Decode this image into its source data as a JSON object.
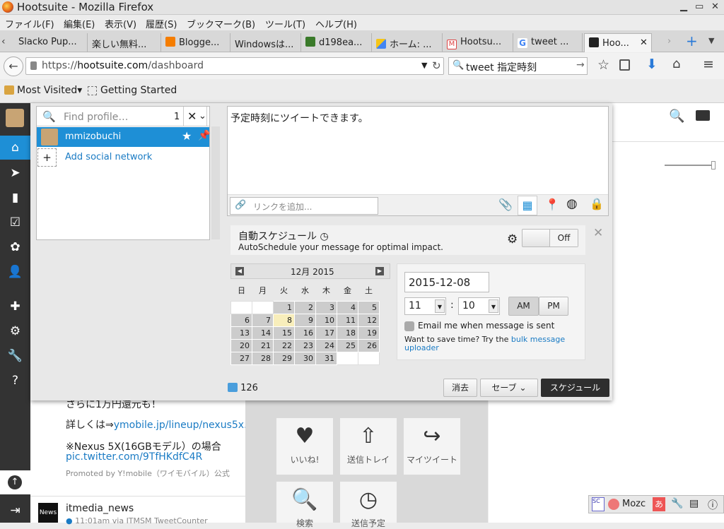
{
  "window": {
    "title": "Hootsuite - Mozilla Firefox"
  },
  "menu": [
    "ファイル(F)",
    "編集(E)",
    "表示(V)",
    "履歴(S)",
    "ブックマーク(B)",
    "ツール(T)",
    "ヘルプ(H)"
  ],
  "tabs": [
    {
      "label": "Slacko Pup...",
      "color": "#fff"
    },
    {
      "label": "楽しい無料...",
      "color": "#fff"
    },
    {
      "label": "Blogge...",
      "color": "#f57d00"
    },
    {
      "label": "Windowsは...",
      "color": "#fff"
    },
    {
      "label": "d198ea...",
      "color": "#3a7a2a"
    },
    {
      "label": "ホーム: ...",
      "color": "#f5c518"
    },
    {
      "label": "Hootsu...",
      "color": "#d44"
    },
    {
      "label": "tweet ...",
      "color": "#4285f4"
    },
    {
      "label": "Hoo...",
      "color": "#222"
    }
  ],
  "address": {
    "scheme": "https://",
    "host": "hootsuite.com",
    "path": "/dashboard"
  },
  "search": {
    "value": "tweet 指定時刻"
  },
  "bookmarks": {
    "most_visited": "Most Visited",
    "getting_started": "Getting Started"
  },
  "profiles": {
    "placeholder": "Find profile…",
    "count": "1",
    "selected": "mmizobuchi",
    "add": "Add social network"
  },
  "message": {
    "text": "予定時刻にツイートできます。",
    "link_placeholder": "リンクを追加...",
    "char_count": "126"
  },
  "autoschedule": {
    "title": "自動スケジュール",
    "desc": "AutoSchedule your message for optimal impact.",
    "toggle": "Off"
  },
  "calendar": {
    "month": "12月 2015",
    "weekdays": [
      "日",
      "月",
      "火",
      "水",
      "木",
      "金",
      "土"
    ],
    "weeks": [
      [
        "",
        "",
        "1",
        "2",
        "3",
        "4",
        "5"
      ],
      [
        "6",
        "7",
        "8",
        "9",
        "10",
        "11",
        "12"
      ],
      [
        "13",
        "14",
        "15",
        "16",
        "17",
        "18",
        "19"
      ],
      [
        "20",
        "21",
        "22",
        "23",
        "24",
        "25",
        "26"
      ],
      [
        "27",
        "28",
        "29",
        "30",
        "31",
        "",
        ""
      ]
    ],
    "today": "8"
  },
  "schedule": {
    "date": "2015-12-08",
    "hour": "11",
    "minute": "10",
    "am": "AM",
    "pm": "PM",
    "email_label": "Email me when message is sent",
    "save_text": "Want to save time? Try the ",
    "bulk_link": "bulk message uploader"
  },
  "actions": {
    "clear": "消去",
    "save": "セーブ",
    "schedule": "スケジュール"
  },
  "background": {
    "line1": "さらに1万円還元も！",
    "line2": "詳しくは⇒",
    "link1": "ymobile.jp/lineup/nexus5x...",
    "line3": "※Nexus 5X(16GBモデル）の場合",
    "link2": "pic.twitter.com/9TfHKdfC4R",
    "promoted": "Promoted by Y!mobile（ワイモバイル）公式",
    "author": "itmedia_news",
    "meta": "11:01am via ITMSM TweetCounter"
  },
  "tiles": [
    {
      "icon": "heart-icon",
      "label": "いいね!"
    },
    {
      "icon": "outbox-icon",
      "label": "送信トレイ"
    },
    {
      "icon": "retweet-icon",
      "label": "マイツイート"
    },
    {
      "icon": "search-icon",
      "label": "検索"
    },
    {
      "icon": "clock-icon",
      "label": "送信予定"
    }
  ],
  "tray": {
    "ime": "Mozc"
  }
}
